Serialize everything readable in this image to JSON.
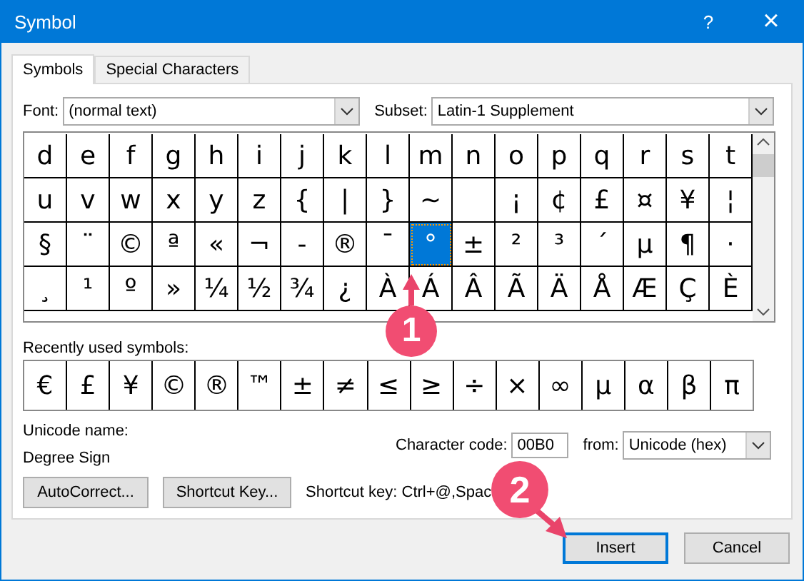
{
  "window": {
    "title": "Symbol",
    "help": "?",
    "close": "×"
  },
  "tabs": [
    {
      "label": "Symbols",
      "selected": true
    },
    {
      "label": "Special Characters",
      "selected": false
    }
  ],
  "font": {
    "label": "Font:",
    "value": "(normal text)"
  },
  "subset": {
    "label": "Subset:",
    "value": "Latin-1 Supplement"
  },
  "symbols": [
    {
      "c": "d",
      "selected": false
    },
    {
      "c": "e",
      "selected": false
    },
    {
      "c": "f",
      "selected": false
    },
    {
      "c": "g",
      "selected": false
    },
    {
      "c": "h",
      "selected": false
    },
    {
      "c": "i",
      "selected": false
    },
    {
      "c": "j",
      "selected": false
    },
    {
      "c": "k",
      "selected": false
    },
    {
      "c": "l",
      "selected": false
    },
    {
      "c": "m",
      "selected": false
    },
    {
      "c": "n",
      "selected": false
    },
    {
      "c": "o",
      "selected": false
    },
    {
      "c": "p",
      "selected": false
    },
    {
      "c": "q",
      "selected": false
    },
    {
      "c": "r",
      "selected": false
    },
    {
      "c": "s",
      "selected": false
    },
    {
      "c": "t",
      "selected": false
    },
    {
      "c": "u",
      "selected": false
    },
    {
      "c": "v",
      "selected": false
    },
    {
      "c": "w",
      "selected": false
    },
    {
      "c": "x",
      "selected": false
    },
    {
      "c": "y",
      "selected": false
    },
    {
      "c": "z",
      "selected": false
    },
    {
      "c": "{",
      "selected": false
    },
    {
      "c": "|",
      "selected": false
    },
    {
      "c": "}",
      "selected": false
    },
    {
      "c": "~",
      "selected": false
    },
    {
      "selected": false
    },
    {
      "c": "¡",
      "selected": false
    },
    {
      "c": "¢",
      "selected": false
    },
    {
      "c": "£",
      "selected": false
    },
    {
      "c": "¤",
      "selected": false
    },
    {
      "c": "¥",
      "selected": false
    },
    {
      "c": "¦",
      "selected": false
    },
    {
      "c": "§",
      "selected": false
    },
    {
      "c": "¨",
      "selected": false
    },
    {
      "c": "©",
      "selected": false
    },
    {
      "c": "ª",
      "selected": false
    },
    {
      "c": "«",
      "selected": false
    },
    {
      "c": "¬",
      "selected": false
    },
    {
      "c": "-",
      "selected": false
    },
    {
      "c": "®",
      "selected": false
    },
    {
      "c": "¯",
      "selected": false
    },
    {
      "c": "°",
      "selected": true
    },
    {
      "c": "±",
      "selected": false
    },
    {
      "c": "²",
      "selected": false
    },
    {
      "c": "³",
      "selected": false
    },
    {
      "c": "´",
      "selected": false
    },
    {
      "c": "µ",
      "selected": false
    },
    {
      "c": "¶",
      "selected": false
    },
    {
      "c": "·",
      "selected": false
    },
    {
      "c": "¸",
      "selected": false
    },
    {
      "c": "¹",
      "selected": false
    },
    {
      "c": "º",
      "selected": false
    },
    {
      "c": "»",
      "selected": false
    },
    {
      "c": "¼",
      "selected": false
    },
    {
      "c": "½",
      "selected": false
    },
    {
      "c": "¾",
      "selected": false
    },
    {
      "c": "¿",
      "selected": false
    },
    {
      "c": "À",
      "selected": false
    },
    {
      "c": "Á",
      "selected": false
    },
    {
      "c": "Â",
      "selected": false
    },
    {
      "c": "Ã",
      "selected": false
    },
    {
      "c": "Ä",
      "selected": false
    },
    {
      "c": "Å",
      "selected": false
    },
    {
      "c": "Æ",
      "selected": false
    },
    {
      "c": "Ç",
      "selected": false
    },
    {
      "c": "È",
      "selected": false
    }
  ],
  "recent": {
    "label": "Recently used symbols:",
    "symbols": [
      "€",
      "£",
      "¥",
      "©",
      "®",
      "™",
      "±",
      "≠",
      "≤",
      "≥",
      "÷",
      "×",
      "∞",
      "µ",
      "α",
      "β",
      "π"
    ]
  },
  "unicode_name": {
    "label": "Unicode name:",
    "value": "Degree Sign"
  },
  "character_code": {
    "label": "Character code:",
    "value": "00B0"
  },
  "from": {
    "label": "from:",
    "value": "Unicode (hex)"
  },
  "autocorrect_button": "AutoCorrect...",
  "shortcut_key_button": "Shortcut Key...",
  "shortcut_text": "Shortcut key: Ctrl+@,Spac",
  "buttons": [
    {
      "label": "Insert",
      "default": true
    },
    {
      "label": "Cancel",
      "default": false
    }
  ],
  "annotations": [
    {
      "label": "1"
    },
    {
      "label": "2"
    }
  ]
}
